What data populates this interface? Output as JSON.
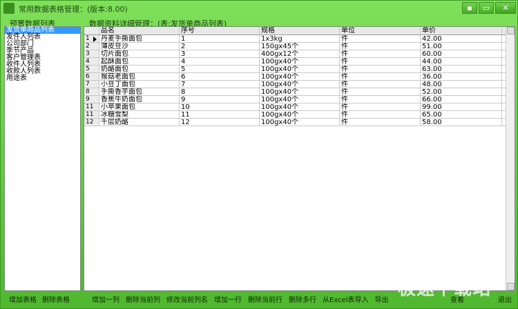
{
  "window": {
    "title": "常用数据表格管理：(版本:8.00)",
    "buttons": [
      "▪",
      "▭",
      "✕"
    ]
  },
  "left_panel": {
    "label": "预置数据列表",
    "items": [
      "发货单商品列表",
      "发件人列表",
      "公司部门",
      "季节产品",
      "客户管理表",
      "收件人列表",
      "收款人列表",
      "用途表"
    ],
    "selected_index": 0
  },
  "right_panel": {
    "label": "数据资料详细管理：(表:发货单商品列表)",
    "columns": [
      "品名",
      "序号",
      "规格",
      "单位",
      "单价"
    ],
    "rows": [
      [
        "1",
        "丹麦手撕面包",
        "1",
        "1x3kg",
        "件",
        "42.00"
      ],
      [
        "2",
        "薄皮豆沙",
        "2",
        "150gx45个",
        "件",
        "51.00"
      ],
      [
        "3",
        "切片面包",
        "3",
        "400gx12个",
        "件",
        "60.00"
      ],
      [
        "4",
        "起酥面包",
        "4",
        "100gx40个",
        "件",
        "44.00"
      ],
      [
        "5",
        "奶酪面包",
        "5",
        "100gx40个",
        "件",
        "63.00"
      ],
      [
        "6",
        "猴菇老面包",
        "6",
        "100gx40个",
        "件",
        "36.00"
      ],
      [
        "7",
        "小豆丁面包",
        "7",
        "100gx40个",
        "件",
        "48.00"
      ],
      [
        "8",
        "手撕香芋面包",
        "8",
        "100gx40个",
        "件",
        "52.00"
      ],
      [
        "9",
        "香蕉牛奶面包",
        "9",
        "100gx40个",
        "件",
        "66.00"
      ],
      [
        "11",
        "小苹果面包",
        "10",
        "100gx40个",
        "件",
        "99.00"
      ],
      [
        "11",
        "冰糖雪梨",
        "11",
        "100gx40个",
        "件",
        "65.00"
      ],
      [
        "12",
        "千层奶酪",
        "12",
        "100gx40个",
        "件",
        "58.00"
      ]
    ]
  },
  "left_toolbar": [
    "增加表格",
    "删除表格"
  ],
  "right_toolbar": [
    "增加一列",
    "删除当前列",
    "修改当前列名",
    "增加一行",
    "删除当前行",
    "删除多行",
    "从Excel表导入",
    "导出"
  ],
  "bottom_right": {
    "view": "查看",
    "exit": "退出"
  },
  "watermark": "极速下载站"
}
